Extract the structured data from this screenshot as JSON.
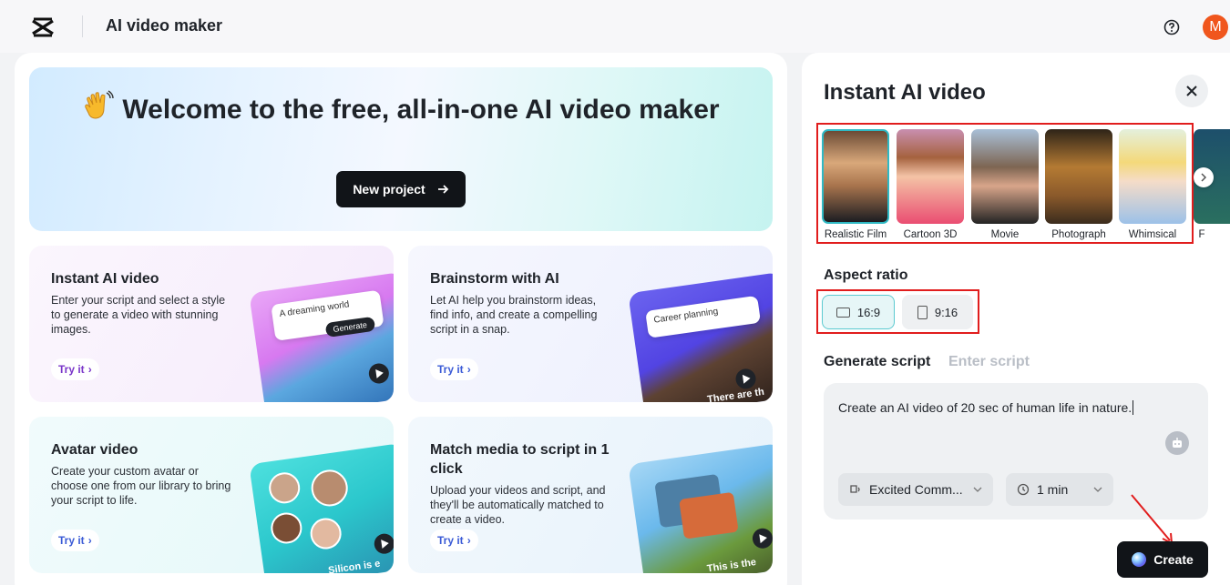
{
  "header": {
    "app_title": "AI video maker",
    "avatar_initial": "M",
    "logo_icon": "capcut-logo-icon",
    "help_icon": "help-circle-icon"
  },
  "hero": {
    "title": "Welcome to the free, all-in-one AI video maker",
    "wave_icon": "waving-hand-icon",
    "button_label": "New project"
  },
  "cards": [
    {
      "title": "Instant AI video",
      "description": "Enter your script and select a style to generate a video with stunning images.",
      "try_label": "Try it",
      "illus_tag": "A dreaming world",
      "illus_button": "Generate"
    },
    {
      "title": "Brainstorm with AI",
      "description": "Let AI help you brainstorm ideas, find info, and create a compelling script in a snap.",
      "try_label": "Try it",
      "illus_tag": "Career planning",
      "illus_caption": "There are th"
    },
    {
      "title": "Avatar video",
      "description": "Create your custom avatar or choose one from our library to bring your script to life.",
      "try_label": "Try it",
      "illus_caption": "Silicon is e"
    },
    {
      "title": "Match media to script in 1 click",
      "description": "Upload your videos and script, and they'll be automatically matched to create a video.",
      "try_label": "Try it",
      "illus_caption": "This is the"
    }
  ],
  "panel": {
    "title": "Instant AI video",
    "styles": [
      {
        "label": "Realistic Film",
        "selected": true,
        "colors": [
          "#3a2a22",
          "#c89b6a"
        ]
      },
      {
        "label": "Cartoon 3D",
        "selected": false,
        "colors": [
          "#d88aa8",
          "#ef5e7e"
        ]
      },
      {
        "label": "Movie",
        "selected": false,
        "colors": [
          "#9bb3c9",
          "#3b2c24"
        ]
      },
      {
        "label": "Photograph",
        "selected": false,
        "colors": [
          "#3a2b1f",
          "#c08a3c"
        ]
      },
      {
        "label": "Whimsical",
        "selected": false,
        "colors": [
          "#d9ecd7",
          "#9cc0e6"
        ]
      },
      {
        "label": "F",
        "selected": false,
        "colors": [
          "#1d4f6b",
          "#2a6f5f"
        ]
      }
    ],
    "aspect_ratio_label": "Aspect ratio",
    "aspect_ratios": [
      "16:9",
      "9:16"
    ],
    "tabs": [
      "Generate script",
      "Enter script"
    ],
    "script_text": "Create an AI video of 20 sec of human life in nature.",
    "voice_value": "Excited Comm...",
    "duration_value": "1 min",
    "create_label": "Create"
  },
  "colors": {
    "highlight_red": "#e11d1d",
    "accent_teal": "#2fb9c4",
    "button_dark": "#111418",
    "avatar_orange": "#f0561d"
  }
}
